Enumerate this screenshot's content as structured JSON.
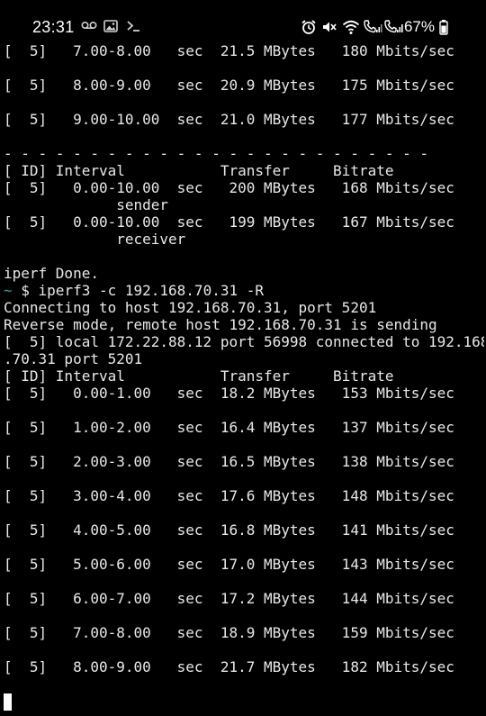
{
  "status_bar": {
    "time": "23:31",
    "left_icons": [
      "voicemail-icon",
      "image-icon",
      "terminal-icon"
    ],
    "right_icons": [
      "alarm-icon",
      "mute-icon",
      "wifi-icon",
      "call-signal-1-icon",
      "call-signal-2-icon",
      "battery-icon"
    ],
    "battery_percent": "67%"
  },
  "terminal": {
    "lines": [
      "[  5]   7.00-8.00   sec  21.5 MBytes   180 Mbits/sec",
      "",
      "[  5]   8.00-9.00   sec  20.9 MBytes   175 Mbits/sec",
      "",
      "[  5]   9.00-10.00  sec  21.0 MBytes   177 Mbits/sec",
      "",
      "- - - - - - - - - - - - - - - - - - - - - - - - -",
      "[ ID] Interval           Transfer     Bitrate",
      "[  5]   0.00-10.00  sec   200 MBytes   168 Mbits/sec",
      "             sender",
      "[  5]   0.00-10.00  sec   199 MBytes   167 Mbits/sec",
      "             receiver",
      "",
      "iperf Done.",
      "~ $ iperf3 -c 192.168.70.31 -R",
      "Connecting to host 192.168.70.31, port 5201",
      "Reverse mode, remote host 192.168.70.31 is sending",
      "[  5] local 172.22.88.12 port 56998 connected to 192.168",
      ".70.31 port 5201",
      "[ ID] Interval           Transfer     Bitrate",
      "[  5]   0.00-1.00   sec  18.2 MBytes   153 Mbits/sec",
      "",
      "[  5]   1.00-2.00   sec  16.4 MBytes   137 Mbits/sec",
      "",
      "[  5]   2.00-3.00   sec  16.5 MBytes   138 Mbits/sec",
      "",
      "[  5]   3.00-4.00   sec  17.6 MBytes   148 Mbits/sec",
      "",
      "[  5]   4.00-5.00   sec  16.8 MBytes   141 Mbits/sec",
      "",
      "[  5]   5.00-6.00   sec  17.0 MBytes   143 Mbits/sec",
      "",
      "[  5]   6.00-7.00   sec  17.2 MBytes   144 Mbits/sec",
      "",
      "[  5]   7.00-8.00   sec  18.9 MBytes   159 Mbits/sec",
      "",
      "[  5]   8.00-9.00   sec  21.7 MBytes   182 Mbits/sec",
      ""
    ],
    "prompt_color": "#2fa0a0",
    "text_color": "#e8e8e8",
    "background": "#000000"
  }
}
